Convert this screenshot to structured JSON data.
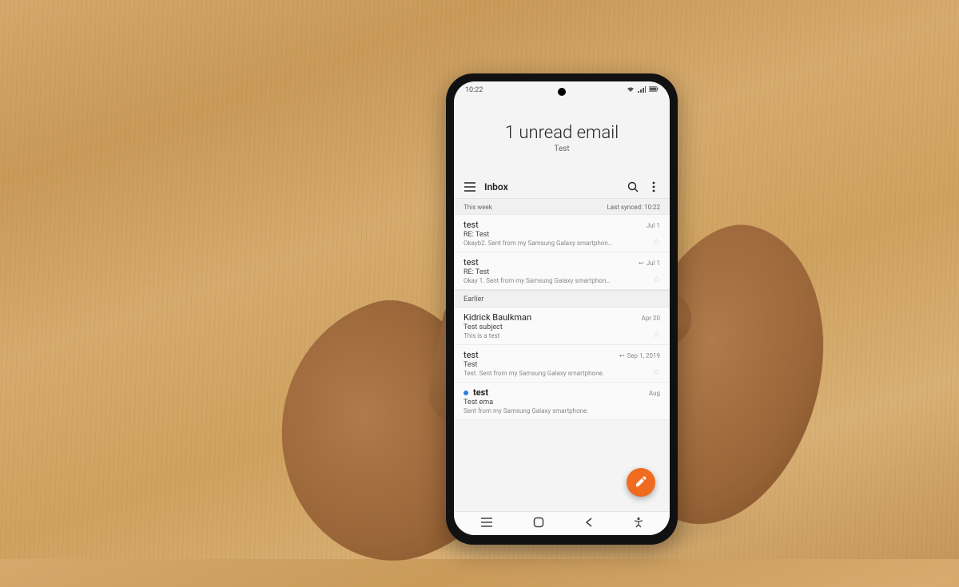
{
  "status": {
    "time": "10:22"
  },
  "hero": {
    "title": "1 unread email",
    "subtitle": "Test"
  },
  "toolbar": {
    "label": "Inbox"
  },
  "sections": {
    "thisweek": {
      "label": "This week",
      "sync": "Last synced: 10:22"
    },
    "earlier": {
      "label": "Earlier"
    }
  },
  "emails": [
    {
      "sender": "test",
      "date": "Jul 1",
      "replied": false,
      "subject": "RE: Test",
      "preview": "Okayb2. Sent from my Samsung Galaxy smartphon…",
      "unread": false
    },
    {
      "sender": "test",
      "date": "Jul 1",
      "replied": true,
      "subject": "RE: Test",
      "preview": "Okay 1. Sent from my Samsung Galaxy smartphon…",
      "unread": false
    },
    {
      "sender": "Kidrick Baulkman",
      "date": "Apr 20",
      "replied": false,
      "subject": "Test subject",
      "preview": "This is a test",
      "unread": false
    },
    {
      "sender": "test",
      "date": "Sep 1, 2019",
      "replied": true,
      "subject": "Test",
      "preview": "Test. Sent from my Samsung Galaxy smartphone.",
      "unread": false
    },
    {
      "sender": "test",
      "date": "Aug",
      "replied": false,
      "subject": "Test ema",
      "preview": "Sent from my Samsung Galaxy smartphone.",
      "unread": true
    }
  ]
}
